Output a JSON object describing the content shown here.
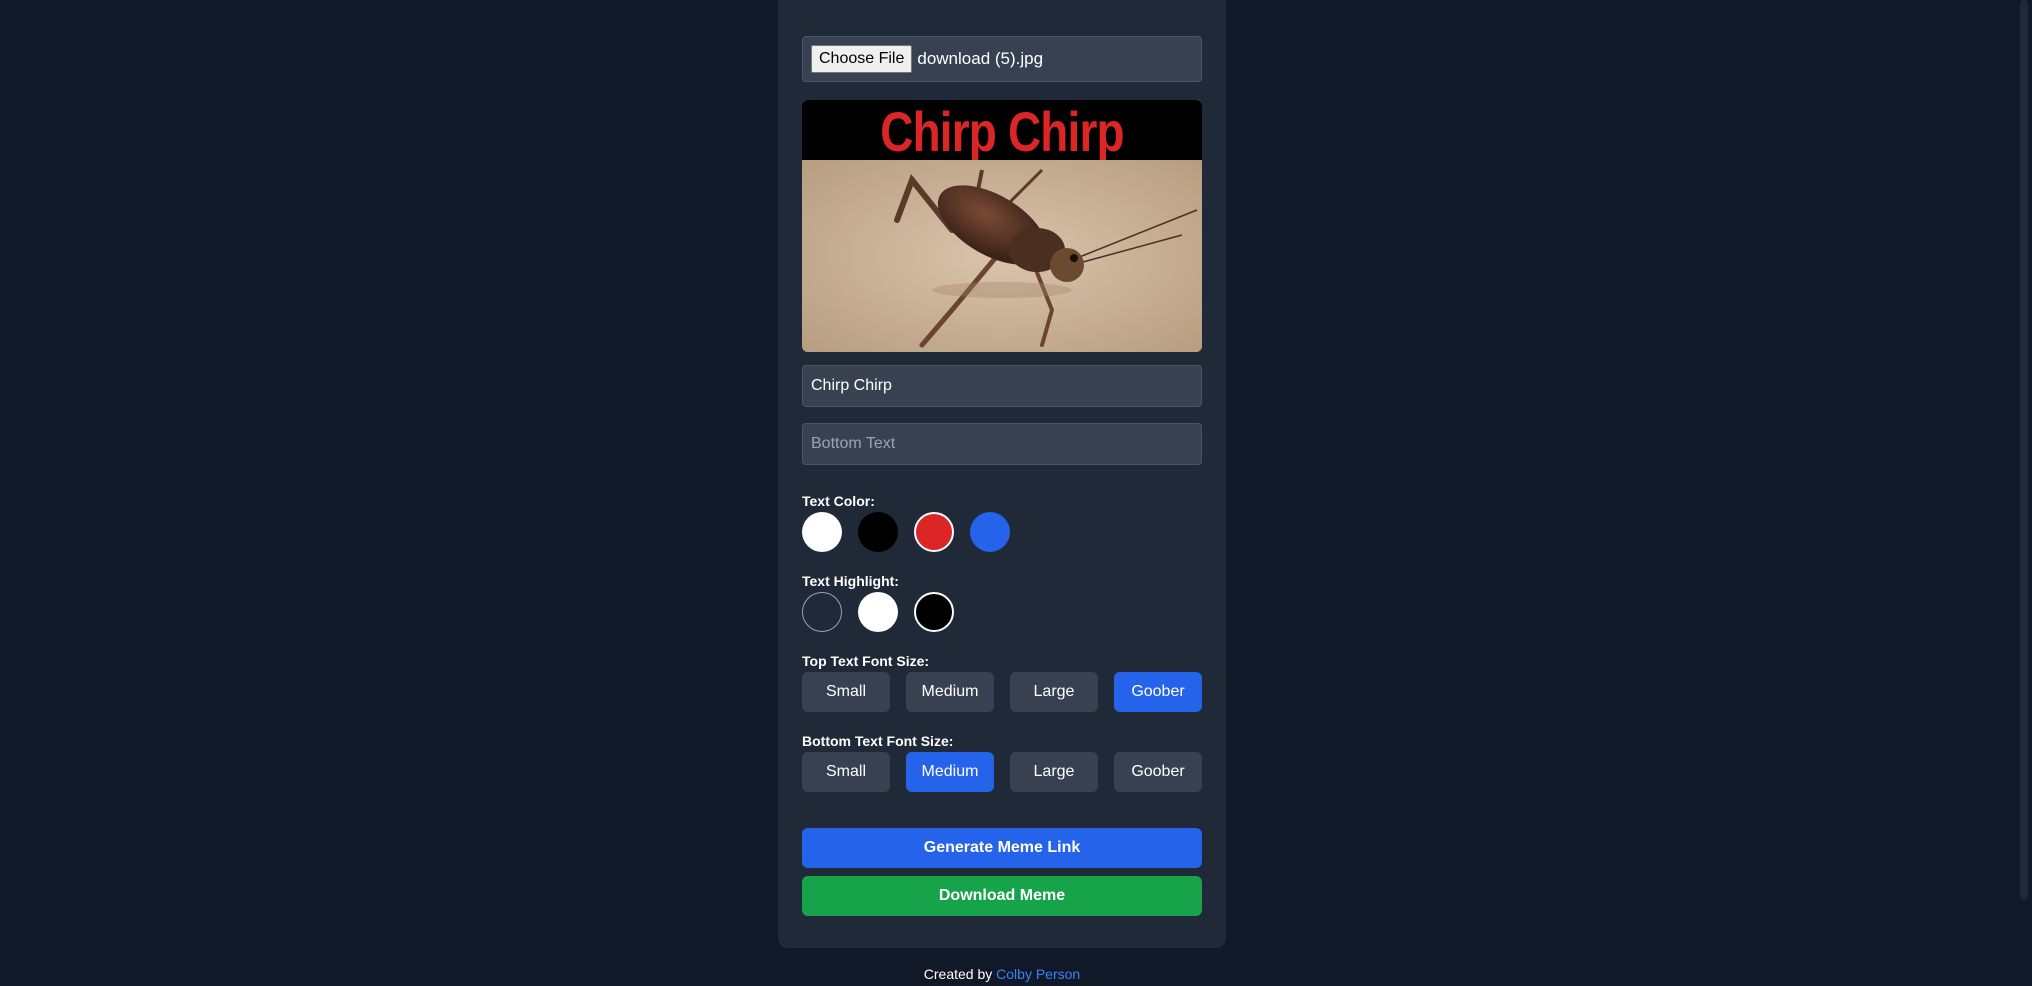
{
  "file_input": {
    "button_label": "Choose File",
    "file_name": "download (5).jpg"
  },
  "preview": {
    "top_text": "Chirp Chirp"
  },
  "inputs": {
    "top_text_value": "Chirp Chirp",
    "bottom_text_placeholder": "Bottom Text"
  },
  "text_color": {
    "label": "Text Color:",
    "swatches": [
      "#ffffff",
      "#000000",
      "#dc2626",
      "#2563eb"
    ],
    "selected": "#dc2626"
  },
  "text_highlight": {
    "label": "Text Highlight:",
    "swatches": [
      "transparent",
      "#ffffff",
      "#000000"
    ],
    "selected": "#000000"
  },
  "top_font_size": {
    "label": "Top Text Font Size:",
    "options": [
      "Small",
      "Medium",
      "Large",
      "Goober"
    ],
    "selected": "Goober"
  },
  "bottom_font_size": {
    "label": "Bottom Text Font Size:",
    "options": [
      "Small",
      "Medium",
      "Large",
      "Goober"
    ],
    "selected": "Medium"
  },
  "actions": {
    "generate_label": "Generate Meme Link",
    "download_label": "Download Meme",
    "generate_color": "#2563eb",
    "download_color": "#16a34a"
  },
  "footer": {
    "prefix": "Created by",
    "author": "Colby Person"
  }
}
